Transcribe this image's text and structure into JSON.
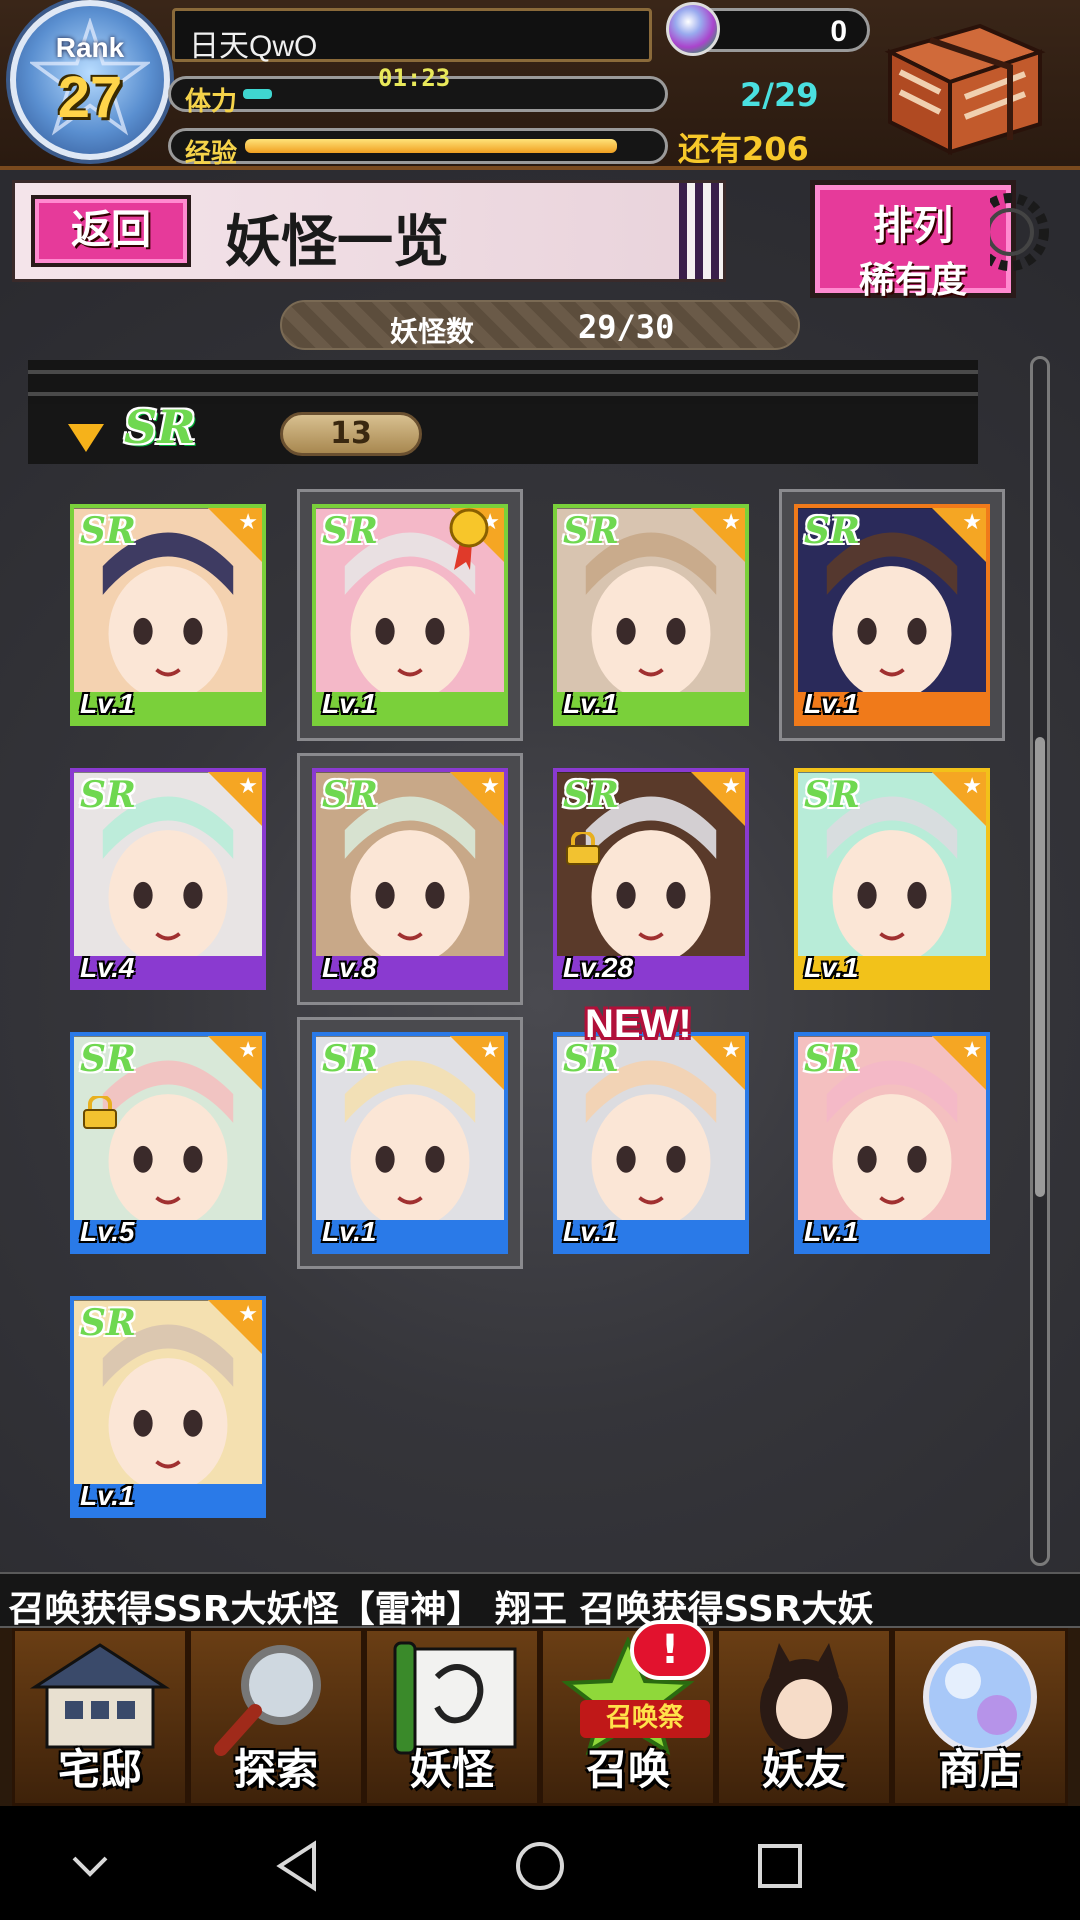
{
  "player": {
    "rank_label": "Rank",
    "rank": "27",
    "name": "日天QwO",
    "gems": "0",
    "stamina_label": "体力",
    "stamina_timer": "01:23",
    "stamina": "2/29",
    "stamina_fraction": 0.069,
    "exp_label": "经验",
    "exp_remaining": "还有206",
    "exp_fraction": 0.93
  },
  "header": {
    "back_label": "返回",
    "title": "妖怪一览",
    "sort_label": "排列",
    "sort_value": "稀有度"
  },
  "count": {
    "label": "妖怪数",
    "value": "29/30"
  },
  "section": {
    "rarity": "SR",
    "count": "13"
  },
  "cards": [
    {
      "rarity": "SR",
      "level": "Lv.1",
      "frame": "#7ad03a",
      "selected": false
    },
    {
      "rarity": "SR",
      "level": "Lv.1",
      "frame": "#7ad03a",
      "selected": true,
      "medal": true
    },
    {
      "rarity": "SR",
      "level": "Lv.1",
      "frame": "#7ad03a",
      "selected": false
    },
    {
      "rarity": "SR",
      "level": "Lv.1",
      "frame": "#f07a1a",
      "selected": true
    },
    {
      "rarity": "SR",
      "level": "Lv.4",
      "frame": "#8a3ad0",
      "selected": false
    },
    {
      "rarity": "SR",
      "level": "Lv.8",
      "frame": "#8a3ad0",
      "selected": true
    },
    {
      "rarity": "SR",
      "level": "Lv.28",
      "frame": "#8a3ad0",
      "selected": false,
      "locked": true
    },
    {
      "rarity": "SR",
      "level": "Lv.1",
      "frame": "#f2c21a",
      "selected": false
    },
    {
      "rarity": "SR",
      "level": "Lv.5",
      "frame": "#2a7ae8",
      "selected": false,
      "locked": true
    },
    {
      "rarity": "SR",
      "level": "Lv.1",
      "frame": "#2a7ae8",
      "selected": true
    },
    {
      "rarity": "SR",
      "level": "Lv.1",
      "frame": "#2a7ae8",
      "selected": false,
      "new": true
    },
    {
      "rarity": "SR",
      "level": "Lv.1",
      "frame": "#2a7ae8",
      "selected": false
    },
    {
      "rarity": "SR",
      "level": "Lv.1",
      "frame": "#2a7ae8",
      "selected": false
    }
  ],
  "new_tag": "NEW!",
  "ticker": "梦 召唤获得SSR大妖怪【雷神】   翔王 召唤获得SSR大妖",
  "nav": {
    "home": "宅邸",
    "explore": "探索",
    "yokai": "妖怪",
    "summon": "召唤",
    "friends": "妖友",
    "shop": "商店",
    "alert": "!",
    "summon_event": "召唤祭"
  }
}
